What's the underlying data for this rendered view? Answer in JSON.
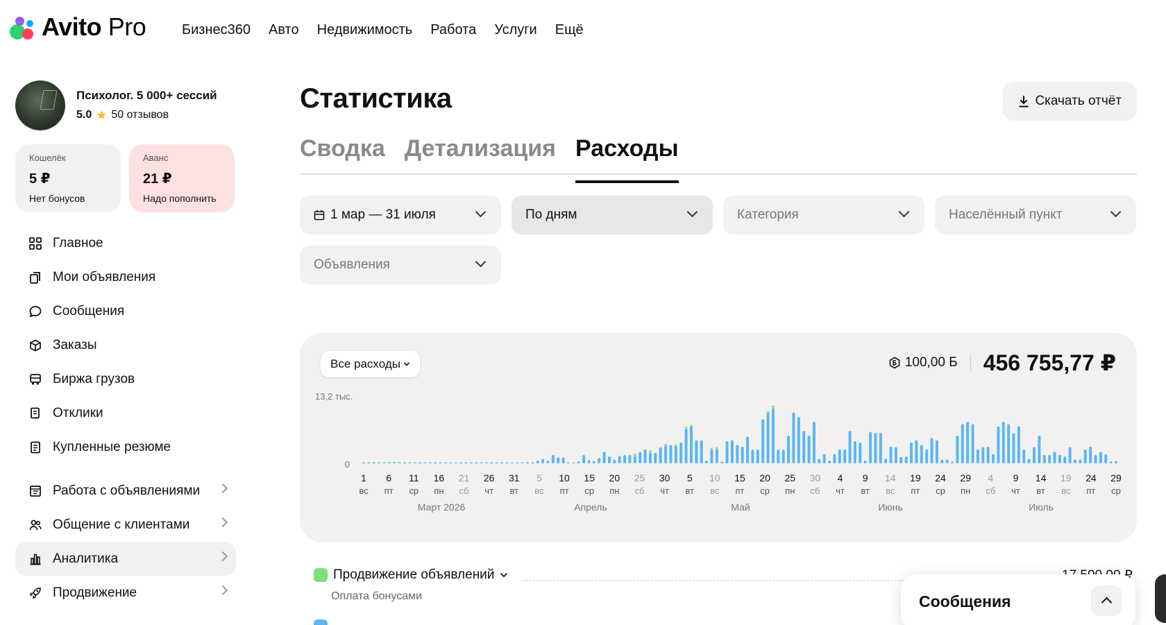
{
  "brand": {
    "name": "Avito",
    "suffix": "Pro"
  },
  "topnav": [
    "Бизнес360",
    "Авто",
    "Недвижимость",
    "Работа",
    "Услуги",
    "Ещё"
  ],
  "profile": {
    "name": "Психолог. 5 000+ сессий",
    "score": "5.0",
    "reviews": "50 отзывов"
  },
  "wallet": {
    "title": "Кошелёк",
    "value": "5 ₽",
    "sub": "Нет бонусов"
  },
  "advance": {
    "title": "Аванс",
    "value": "21 ₽",
    "sub": "Надо пополнить"
  },
  "menu": [
    {
      "label": "Главное",
      "icon": "grid-icon"
    },
    {
      "label": "Мои объявления",
      "icon": "copy-icon"
    },
    {
      "label": "Сообщения",
      "icon": "chat-icon"
    },
    {
      "label": "Заказы",
      "icon": "box-icon"
    },
    {
      "label": "Биржа грузов",
      "icon": "truck-icon"
    },
    {
      "label": "Отклики",
      "icon": "response-icon"
    },
    {
      "label": "Купленные резюме",
      "icon": "resume-icon"
    }
  ],
  "menu2": [
    {
      "label": "Работа с объявлениями",
      "icon": "ads-icon"
    },
    {
      "label": "Общение с клиентами",
      "icon": "users-icon"
    },
    {
      "label": "Аналитика",
      "icon": "chart-icon"
    },
    {
      "label": "Продвижение",
      "icon": "rocket-icon"
    }
  ],
  "page": {
    "title": "Статистика",
    "download": "Скачать отчёт"
  },
  "tabs": [
    "Сводка",
    "Детализация",
    "Расходы"
  ],
  "filters": {
    "period": "1 мар — 31 июля",
    "granularity": "По дням",
    "category": "Категория",
    "city": "Населённый пункт",
    "ads": "Объявления"
  },
  "summary": {
    "all_label": "Все расходы",
    "bonus": "100,00 Б",
    "total": "456 755,77 ₽"
  },
  "colors": {
    "blue": "#5bb6f2",
    "green": "#7ce07a",
    "accent": "#111111"
  },
  "chart_data": {
    "type": "bar",
    "ytick_top": "13,2 тыс.",
    "ytick_zero": "0",
    "ylim": [
      0,
      13200
    ],
    "months": [
      "Март 2026",
      "Апрель",
      "Май",
      "Июнь",
      "Июль"
    ],
    "x_ticks": [
      {
        "d": "1",
        "w": "вс",
        "we": false
      },
      {
        "d": "6",
        "w": "пт",
        "we": false
      },
      {
        "d": "11",
        "w": "ср",
        "we": false
      },
      {
        "d": "16",
        "w": "пн",
        "we": false
      },
      {
        "d": "21",
        "w": "сб",
        "we": true
      },
      {
        "d": "26",
        "w": "чт",
        "we": false
      },
      {
        "d": "31",
        "w": "вт",
        "we": false
      },
      {
        "d": "5",
        "w": "вс",
        "we": true
      },
      {
        "d": "10",
        "w": "пт",
        "we": false
      },
      {
        "d": "15",
        "w": "ср",
        "we": false
      },
      {
        "d": "20",
        "w": "пн",
        "we": false
      },
      {
        "d": "25",
        "w": "сб",
        "we": true
      },
      {
        "d": "30",
        "w": "чт",
        "we": false
      },
      {
        "d": "5",
        "w": "вт",
        "we": false
      },
      {
        "d": "10",
        "w": "вс",
        "we": true
      },
      {
        "d": "15",
        "w": "пт",
        "we": false
      },
      {
        "d": "20",
        "w": "ср",
        "we": false
      },
      {
        "d": "25",
        "w": "пн",
        "we": false
      },
      {
        "d": "30",
        "w": "сб",
        "we": true
      },
      {
        "d": "4",
        "w": "чт",
        "we": false
      },
      {
        "d": "9",
        "w": "вт",
        "we": false
      },
      {
        "d": "14",
        "w": "вс",
        "we": true
      },
      {
        "d": "19",
        "w": "пт",
        "we": false
      },
      {
        "d": "24",
        "w": "ср",
        "we": false
      },
      {
        "d": "29",
        "w": "пн",
        "we": false
      },
      {
        "d": "4",
        "w": "сб",
        "we": true
      },
      {
        "d": "9",
        "w": "чт",
        "we": false
      },
      {
        "d": "14",
        "w": "вт",
        "we": false
      },
      {
        "d": "19",
        "w": "вс",
        "we": true
      },
      {
        "d": "24",
        "w": "пт",
        "we": false
      },
      {
        "d": "29",
        "w": "ср",
        "we": false
      }
    ],
    "series": [
      {
        "color": "#5bb6f2",
        "values": [
          100,
          100,
          100,
          100,
          150,
          150,
          150,
          150,
          100,
          100,
          50,
          50,
          50,
          50,
          50,
          50,
          50,
          50,
          50,
          50,
          50,
          50,
          50,
          50,
          50,
          50,
          50,
          50,
          50,
          50,
          50,
          50,
          300,
          200,
          600,
          1000,
          600,
          1800,
          1300,
          1300,
          200,
          200,
          400,
          1800,
          700,
          500,
          1200,
          2500,
          1500,
          800,
          1600,
          1800,
          1800,
          1600,
          2500,
          3000,
          2300,
          2300,
          3500,
          3800,
          4000,
          3800,
          4500,
          7500,
          8000,
          5000,
          5000,
          600,
          3000,
          3200,
          400,
          4800,
          5000,
          4000,
          3600,
          5800,
          3000,
          3000,
          9500,
          11000,
          12000,
          3000,
          3000,
          6000,
          11000,
          10000,
          7000,
          6000,
          9000,
          1000,
          2000,
          600,
          2000,
          3000,
          3000,
          7000,
          4800,
          4500,
          600,
          6800,
          6600,
          6600,
          1000,
          3600,
          3500,
          1400,
          1500,
          4500,
          5000,
          4000,
          3000,
          5500,
          5000,
          800,
          800,
          400,
          6000,
          8500,
          9000,
          8500,
          3000,
          3500,
          3600,
          2000,
          8000,
          9000,
          8500,
          6500,
          8000,
          3000,
          1000,
          3500,
          6000,
          1800,
          1800,
          2500,
          1800,
          1500,
          3500,
          800,
          800,
          3000,
          3600,
          1800,
          2500,
          2000,
          400,
          500
        ]
      },
      {
        "color": "#7ce07a",
        "values": [
          0,
          0,
          80,
          0,
          120,
          100,
          150,
          100,
          0,
          0,
          0,
          0,
          0,
          0,
          0,
          0,
          0,
          0,
          0,
          0,
          0,
          0,
          0,
          0,
          0,
          0,
          0,
          0,
          0,
          0,
          0,
          0,
          0,
          0,
          0,
          0,
          0,
          0,
          0,
          0,
          0,
          0,
          0,
          0,
          0,
          0,
          0,
          0,
          0,
          0,
          0,
          0,
          0,
          500,
          0,
          0,
          500,
          0,
          0,
          400,
          0,
          300,
          0,
          400,
          300,
          0,
          0,
          0,
          400,
          300,
          0,
          0,
          0,
          0,
          0,
          0,
          0,
          0,
          0,
          300,
          500,
          0,
          0,
          0,
          0,
          0,
          0,
          0,
          0,
          0,
          0,
          0,
          0,
          0,
          0,
          0,
          0,
          0,
          0,
          0,
          0,
          0,
          0,
          0,
          0,
          0,
          0,
          0,
          0,
          0,
          0,
          0,
          0,
          0,
          0,
          0,
          0,
          0,
          0,
          0,
          0,
          0,
          0,
          0,
          0,
          0,
          0,
          0,
          0,
          0,
          0,
          0,
          0,
          0,
          0,
          0,
          0,
          0,
          0,
          0,
          0,
          0,
          0,
          0,
          0,
          0,
          0,
          0
        ]
      }
    ]
  },
  "legend": {
    "promo": "Продвижение объявлений",
    "promo_sub": "Оплата бонусами",
    "promo_amount": "17 500,00 ₽"
  },
  "messages": {
    "title": "Сообщения"
  }
}
